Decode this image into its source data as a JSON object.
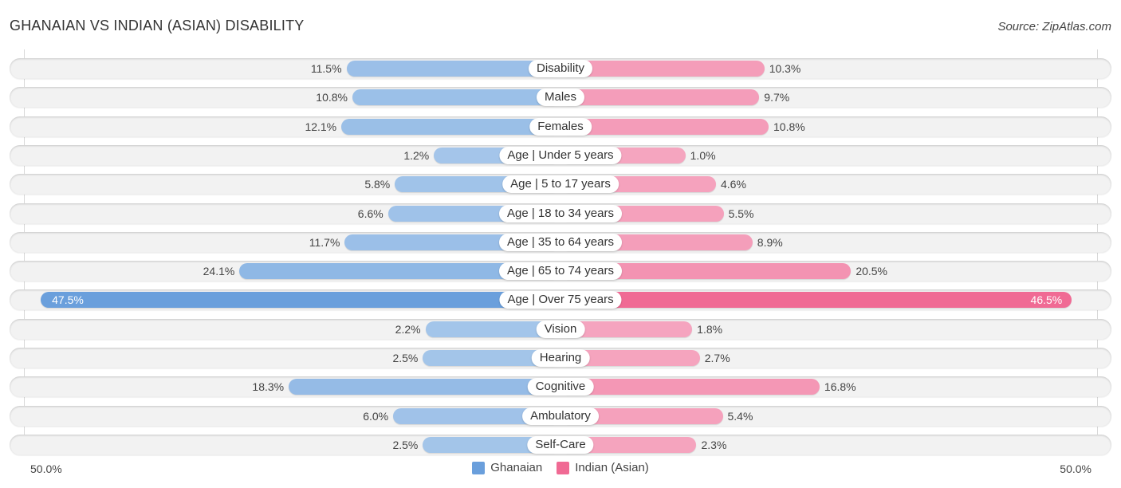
{
  "header": {
    "title": "GHANAIAN VS INDIAN (ASIAN) DISABILITY",
    "source": "Source: ZipAtlas.com"
  },
  "colors": {
    "ghanaian": "#6a9fdc",
    "ghanaian_light": "#a5c6ea",
    "indian": "#f06a94",
    "indian_light": "#f5a6c0"
  },
  "axis": {
    "left_label": "50.0%",
    "right_label": "50.0%"
  },
  "legend": [
    {
      "name": "Ghanaian",
      "color": "#6a9fdc"
    },
    {
      "name": "Indian (Asian)",
      "color": "#f06a94"
    }
  ],
  "chart_data": {
    "type": "bar",
    "orientation": "horizontal-diverging",
    "title": "GHANAIAN VS INDIAN (ASIAN) DISABILITY",
    "xlabel": "",
    "ylabel": "",
    "xlim": [
      -50,
      50
    ],
    "unit": "%",
    "legend_position": "bottom-center",
    "categories": [
      "Disability",
      "Males",
      "Females",
      "Age | Under 5 years",
      "Age | 5 to 17 years",
      "Age | 18 to 34 years",
      "Age | 35 to 64 years",
      "Age | 65 to 74 years",
      "Age | Over 75 years",
      "Vision",
      "Hearing",
      "Cognitive",
      "Ambulatory",
      "Self-Care"
    ],
    "series": [
      {
        "name": "Ghanaian",
        "side": "left",
        "values": [
          11.5,
          10.8,
          12.1,
          1.2,
          5.8,
          6.6,
          11.7,
          24.1,
          47.5,
          2.2,
          2.5,
          18.3,
          6.0,
          2.5
        ],
        "labels": [
          "11.5%",
          "10.8%",
          "12.1%",
          "1.2%",
          "5.8%",
          "6.6%",
          "11.7%",
          "24.1%",
          "47.5%",
          "2.2%",
          "2.5%",
          "18.3%",
          "6.0%",
          "2.5%"
        ]
      },
      {
        "name": "Indian (Asian)",
        "side": "right",
        "values": [
          10.3,
          9.7,
          10.8,
          1.0,
          4.6,
          5.5,
          8.9,
          20.5,
          46.5,
          1.8,
          2.7,
          16.8,
          5.4,
          2.3
        ],
        "labels": [
          "10.3%",
          "9.7%",
          "10.8%",
          "1.0%",
          "4.6%",
          "5.5%",
          "8.9%",
          "20.5%",
          "46.5%",
          "1.8%",
          "2.7%",
          "16.8%",
          "5.4%",
          "2.3%"
        ]
      }
    ]
  }
}
